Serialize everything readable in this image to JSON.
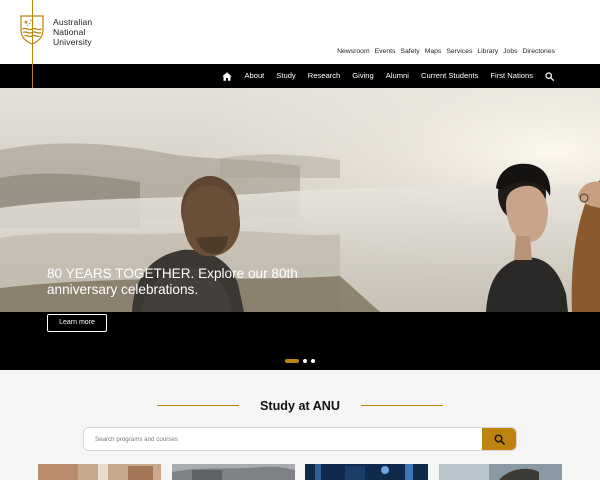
{
  "brand": {
    "line1": "Australian",
    "line2": "National",
    "line3": "University",
    "accent_color": "#be830e"
  },
  "utility_nav": [
    {
      "label": "Newsroom"
    },
    {
      "label": "Events"
    },
    {
      "label": "Safety"
    },
    {
      "label": "Maps"
    },
    {
      "label": "Services"
    },
    {
      "label": "Library"
    },
    {
      "label": "Jobs"
    },
    {
      "label": "Directories"
    }
  ],
  "main_nav": {
    "home_icon": "home-icon",
    "items": [
      {
        "label": "About"
      },
      {
        "label": "Study"
      },
      {
        "label": "Research"
      },
      {
        "label": "Giving"
      },
      {
        "label": "Alumni"
      },
      {
        "label": "Current Students"
      },
      {
        "label": "First Nations"
      }
    ],
    "search_icon": "search-icon"
  },
  "hero": {
    "headline": "80 YEARS TOGETHER. Explore our 80th anniversary celebrations.",
    "button_label": "Learn more",
    "slides": {
      "count": 3,
      "active": 1
    }
  },
  "study": {
    "title": "Study at ANU",
    "search_placeholder": "Search programs and courses",
    "search_button_icon": "search-icon"
  }
}
